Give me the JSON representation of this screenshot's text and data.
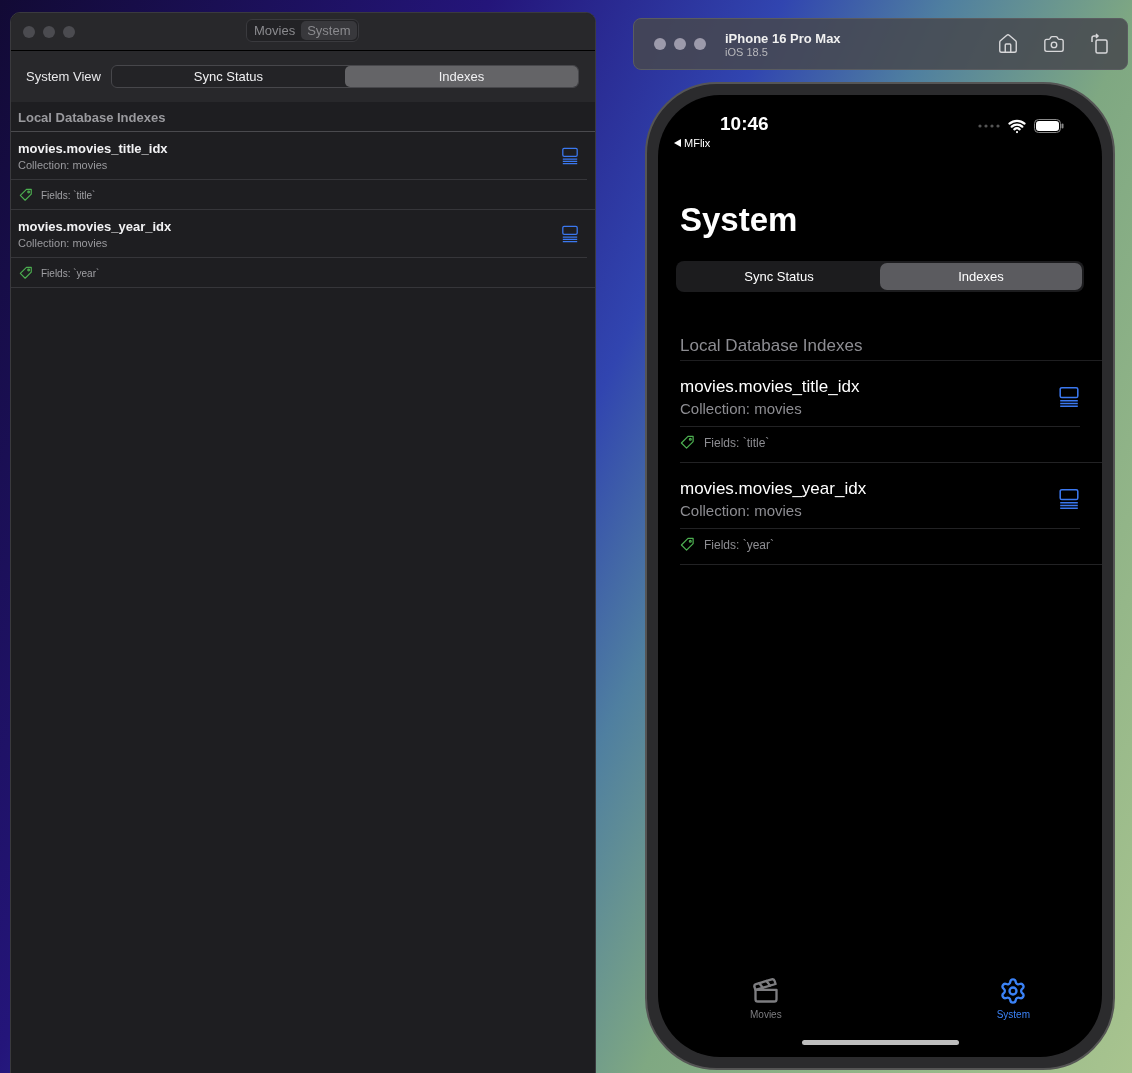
{
  "mac_window": {
    "tabs": [
      {
        "label": "Movies",
        "selected": false
      },
      {
        "label": "System",
        "selected": true
      }
    ],
    "picker_label": "System View",
    "segments": [
      {
        "label": "Sync Status",
        "selected": false
      },
      {
        "label": "Indexes",
        "selected": true
      }
    ],
    "section_title": "Local Database Indexes",
    "indexes": [
      {
        "name": "movies.movies_title_idx",
        "collection": "Collection: movies",
        "fields": "Fields: `title`"
      },
      {
        "name": "movies.movies_year_idx",
        "collection": "Collection: movies",
        "fields": "Fields: `year`"
      }
    ]
  },
  "simulator": {
    "device": "iPhone 16 Pro Max",
    "os": "iOS 18.5"
  },
  "phone": {
    "time": "10:46",
    "back_label": "MFlix",
    "title": "System",
    "segments": [
      {
        "label": "Sync Status",
        "selected": false
      },
      {
        "label": "Indexes",
        "selected": true
      }
    ],
    "section_title": "Local Database Indexes",
    "indexes": [
      {
        "name": "movies.movies_title_idx",
        "collection": "Collection: movies",
        "fields": "Fields: `title`"
      },
      {
        "name": "movies.movies_year_idx",
        "collection": "Collection: movies",
        "fields": "Fields: `year`"
      }
    ],
    "tab_bar": [
      {
        "label": "Movies",
        "kind": "clapper",
        "selected": false
      },
      {
        "label": "System",
        "kind": "gear",
        "selected": true
      }
    ]
  }
}
